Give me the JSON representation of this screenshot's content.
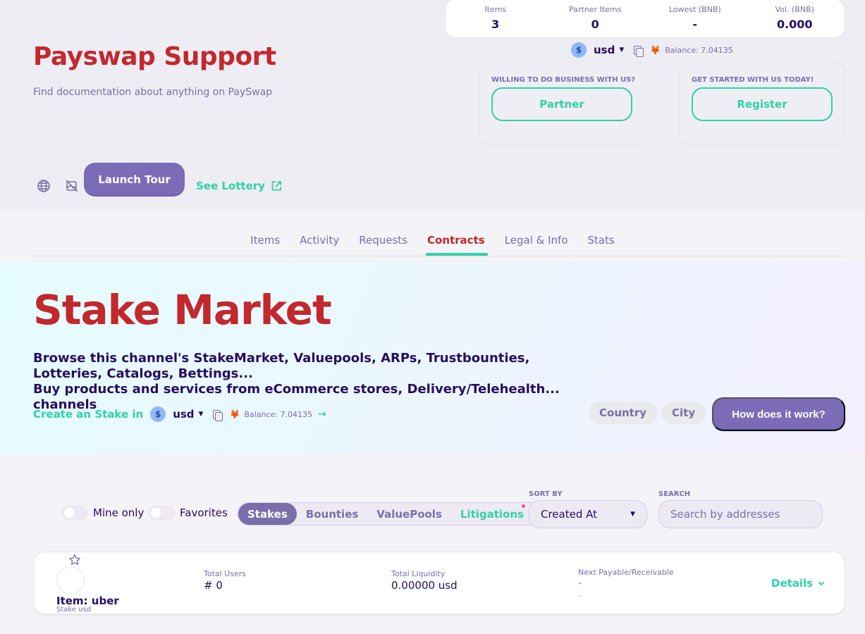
{
  "header": {
    "title": "Payswap Support",
    "subtitle": "Find documentation about anything on PaySwap"
  },
  "stats": [
    {
      "label": "Items",
      "value": "3"
    },
    {
      "label": "Partner Items",
      "value": "0"
    },
    {
      "label": "Lowest (BNB)",
      "value": "-"
    },
    {
      "label": "Vol. (BNB)",
      "value": "0.000"
    }
  ],
  "currency": {
    "coin_symbol": "$",
    "code": "usd",
    "balance": "Balance: 7.04135"
  },
  "cta": {
    "partner_label": "WILLING TO DO BUSINESS WITH US?",
    "partner_button": "Partner",
    "register_label": "GET STARTED WITH US TODAY!",
    "register_button": "Register"
  },
  "toolbar": {
    "launch_tour": "Launch Tour",
    "see_lottery": "See Lottery"
  },
  "tabs": [
    {
      "label": "Items",
      "active": false
    },
    {
      "label": "Activity",
      "active": false
    },
    {
      "label": "Requests",
      "active": false
    },
    {
      "label": "Contracts",
      "active": true
    },
    {
      "label": "Legal & Info",
      "active": false
    },
    {
      "label": "Stats",
      "active": false
    }
  ],
  "hero": {
    "title": "Stake Market",
    "desc_line1": "Browse this channel's StakeMarket, Valuepools, ARPs, Trustbounties, Lotteries, Catalogs, Bettings...",
    "desc_line2": "Buy products and services from eCommerce stores, Delivery/Telehealth... channels",
    "create_label": "Create an Stake in",
    "coin_symbol": "$",
    "currency": "usd",
    "balance": "Balance: 7.04135",
    "country_button": "Country",
    "city_button": "City",
    "how_button": "How does it work?"
  },
  "filters": {
    "mine_only": "Mine only",
    "favorites": "Favorites",
    "segments": [
      "Stakes",
      "Bounties",
      "ValuePools"
    ],
    "active_segment": "Stakes",
    "litigations": "Litigations",
    "sort_label": "SORT BY",
    "sort_value": "Created At",
    "search_label": "SEARCH",
    "search_placeholder": "Search by addresses"
  },
  "stake": {
    "item_name": "Item: uber",
    "item_sub": "Stake usd",
    "total_users_label": "Total Users",
    "total_users_value": "# 0",
    "total_liquidity_label": "Total Liquidity",
    "total_liquidity_value": "0.00000 usd",
    "next_payable_label": "Next Payable/Receivable",
    "next_payable_value": "-",
    "next_receivable_value": "-",
    "details": "Details"
  },
  "colors": {
    "brand_red": "#c2282d",
    "accent_teal": "#31d0aa",
    "primary_purple": "#7c6bb6",
    "text_dark": "#280d5f",
    "text_muted": "#7a6eaa"
  }
}
